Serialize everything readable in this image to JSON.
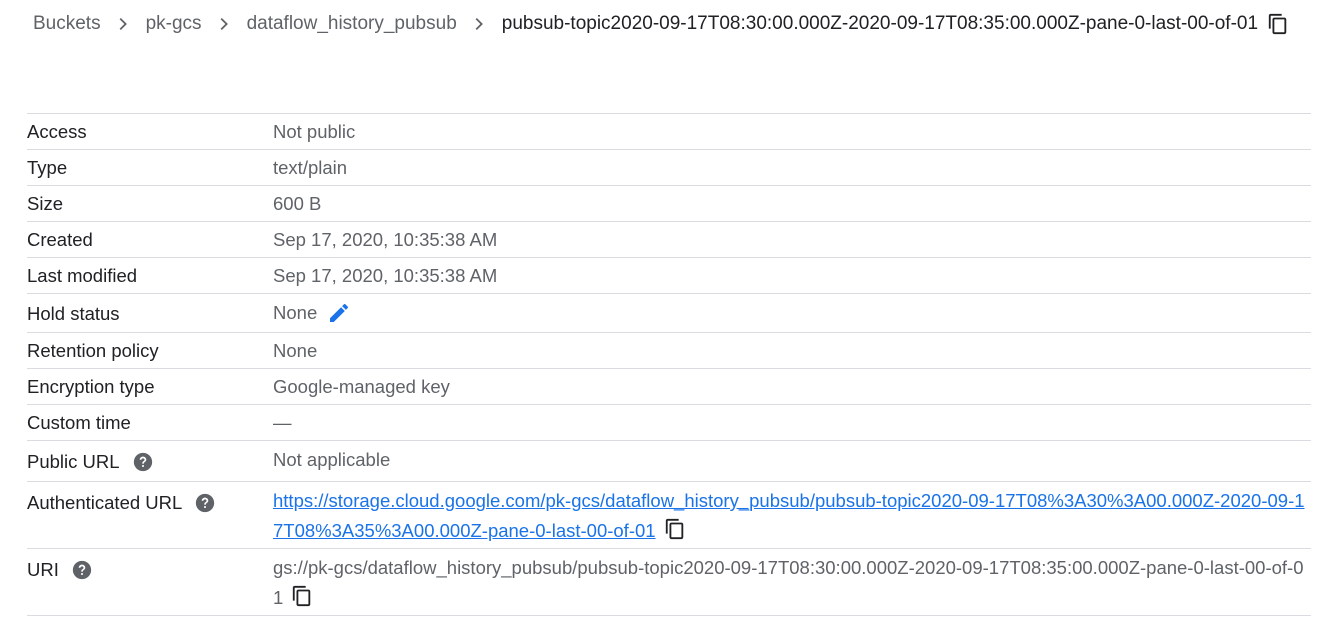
{
  "breadcrumb": {
    "items": [
      "Buckets",
      "pk-gcs",
      "dataflow_history_pubsub"
    ],
    "current": "pubsub-topic2020-09-17T08:30:00.000Z-2020-09-17T08:35:00.000Z-pane-0-last-00-of-01"
  },
  "details": {
    "access": {
      "label": "Access",
      "value": "Not public"
    },
    "type": {
      "label": "Type",
      "value": "text/plain"
    },
    "size": {
      "label": "Size",
      "value": "600 B"
    },
    "created": {
      "label": "Created",
      "value": "Sep 17, 2020, 10:35:38 AM"
    },
    "last_modified": {
      "label": "Last modified",
      "value": "Sep 17, 2020, 10:35:38 AM"
    },
    "hold_status": {
      "label": "Hold status",
      "value": "None"
    },
    "retention_policy": {
      "label": "Retention policy",
      "value": "None"
    },
    "encryption_type": {
      "label": "Encryption type",
      "value": "Google-managed key"
    },
    "custom_time": {
      "label": "Custom time",
      "value": "—"
    },
    "public_url": {
      "label": "Public URL",
      "value": "Not applicable"
    },
    "authenticated_url": {
      "label": "Authenticated URL",
      "value": "https://storage.cloud.google.com/pk-gcs/dataflow_history_pubsub/pubsub-topic2020-09-17T08%3A30%3A00.000Z-2020-09-17T08%3A35%3A00.000Z-pane-0-last-00-of-01"
    },
    "uri": {
      "label": "URI",
      "value": "gs://pk-gcs/dataflow_history_pubsub/pubsub-topic2020-09-17T08:30:00.000Z-2020-09-17T08:35:00.000Z-pane-0-last-00-of-01"
    }
  },
  "icons": {
    "breadcrumb_separator": "chevron-right-icon",
    "copy": "copy-icon",
    "edit": "pencil-icon",
    "help": "help-icon"
  },
  "colors": {
    "link": "#1a73e8",
    "edit_icon": "#1a73e8",
    "help_icon": "#5f6368",
    "divider": "#dadce0"
  }
}
